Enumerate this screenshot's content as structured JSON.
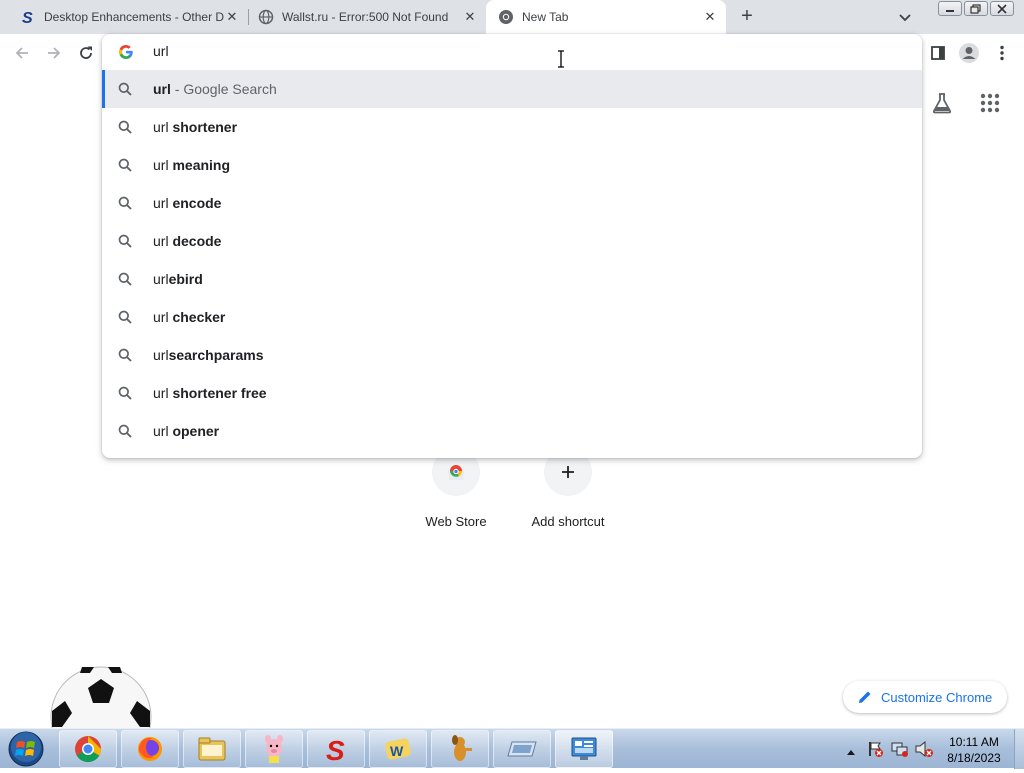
{
  "tabs": [
    {
      "title": "Desktop Enhancements - Other D",
      "icon": "softpedia-s-icon"
    },
    {
      "title": "Wallst.ru - Error:500 Not Found",
      "icon": "globe-icon"
    },
    {
      "title": "New Tab",
      "icon": "chrome-icon",
      "active": true
    }
  ],
  "omnibox": {
    "query": "url",
    "suggestions": [
      {
        "prefix": "url",
        "bold": "",
        "suffix": " - Google Search"
      },
      {
        "prefix": "url ",
        "bold": "shortener",
        "suffix": ""
      },
      {
        "prefix": "url ",
        "bold": "meaning",
        "suffix": ""
      },
      {
        "prefix": "url ",
        "bold": "encode",
        "suffix": ""
      },
      {
        "prefix": "url ",
        "bold": "decode",
        "suffix": ""
      },
      {
        "prefix": "url",
        "bold": "ebird",
        "suffix": ""
      },
      {
        "prefix": "url ",
        "bold": "checker",
        "suffix": ""
      },
      {
        "prefix": "url",
        "bold": "searchparams",
        "suffix": ""
      },
      {
        "prefix": "url ",
        "bold": "shortener free",
        "suffix": ""
      },
      {
        "prefix": "url ",
        "bold": "opener",
        "suffix": ""
      }
    ]
  },
  "ntp": {
    "shortcuts": [
      {
        "label": "Web Store",
        "icon": "chrome-web-store-icon"
      },
      {
        "label": "Add shortcut",
        "icon": "plus-icon"
      }
    ],
    "customize_label": "Customize Chrome"
  },
  "taskbar": {
    "apps": [
      "chrome-icon",
      "firefox-icon",
      "file-explorer-icon",
      "piglet-icon",
      "softpedia-icon",
      "app-blue-icon",
      "dog-icon",
      "drive-icon",
      "control-panel-icon"
    ],
    "time": "10:11 AM",
    "date": "8/18/2023"
  },
  "colors": {
    "accent": "#1a73e8",
    "tabstrip": "#dee1e6",
    "selected_row": "#e8eaed"
  }
}
